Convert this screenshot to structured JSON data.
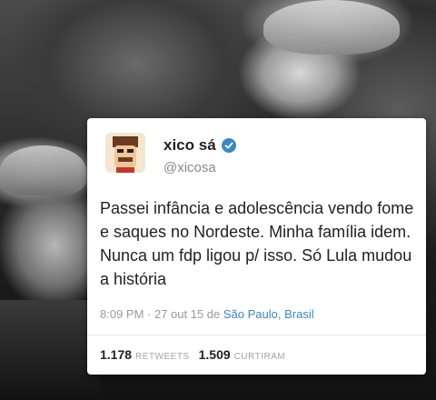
{
  "tweet": {
    "name": "xico sá",
    "handle": "@xicosa",
    "text": "Passei infância e adolescência vendo fome e saques no Nordeste. Minha família idem. Nunca um fdp ligou p/ isso. Só Lula mudou a história",
    "meta_prefix": "8:09 PM · 27 out 15 de ",
    "location": "São Paulo, Brasil",
    "retweets_count": "1.178",
    "retweets_label": "RETWEETS",
    "likes_count": "1.509",
    "likes_label": "CURTIRAM"
  },
  "colors": {
    "verified": "#3b88c3",
    "link": "#3b88c3"
  },
  "icons": {
    "verified": "verified-check-icon"
  }
}
